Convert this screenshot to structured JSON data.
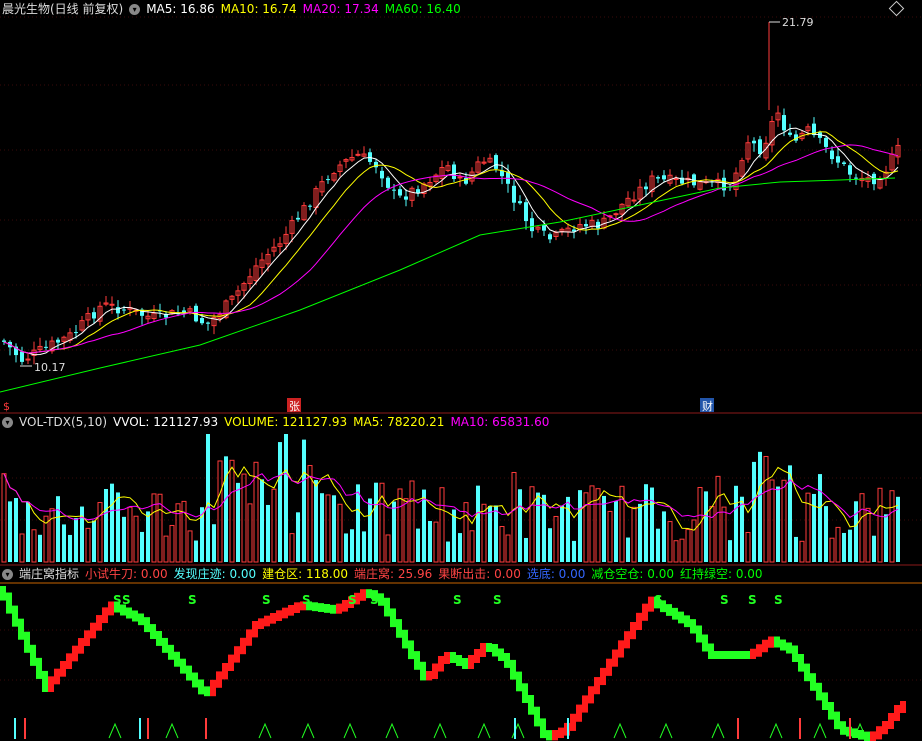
{
  "main": {
    "title": "晨光生物(日线 前复权)",
    "ma5_label": "MA5: 16.86",
    "ma10_label": "MA10: 16.74",
    "ma20_label": "MA20: 17.34",
    "ma60_label": "MA60: 16.40",
    "high_label": "21.79",
    "low_label": "10.17",
    "marker_zhang": "张",
    "marker_cai": "财",
    "marker_left": "$"
  },
  "volume": {
    "title": "VOL-TDX(5,10)",
    "vvol_label": "VVOL: 121127.93",
    "volume_label": "VOLUME: 121127.93",
    "ma5_label": "MA5: 78220.21",
    "ma10_label": "MA10: 65831.60"
  },
  "indicator": {
    "title": "端庄窝指标",
    "i1": "小试牛刀: 0.00",
    "i2": "发现庄迹: 0.00",
    "i3": "建仓区: 118.00",
    "i4": "端庄窝: 25.96",
    "i5": "果断出击: 0.00",
    "i6": "选底: 0.00",
    "i7": "减仓空仓: 0.00",
    "i8": "红持绿空: 0.00",
    "s_label": "S"
  },
  "colors": {
    "up": "#ff3b3b",
    "down": "#54ffff",
    "ma5": "#ffffff",
    "ma10": "#ffff00",
    "ma20": "#ff00ff",
    "ma60": "#00ff00"
  }
}
